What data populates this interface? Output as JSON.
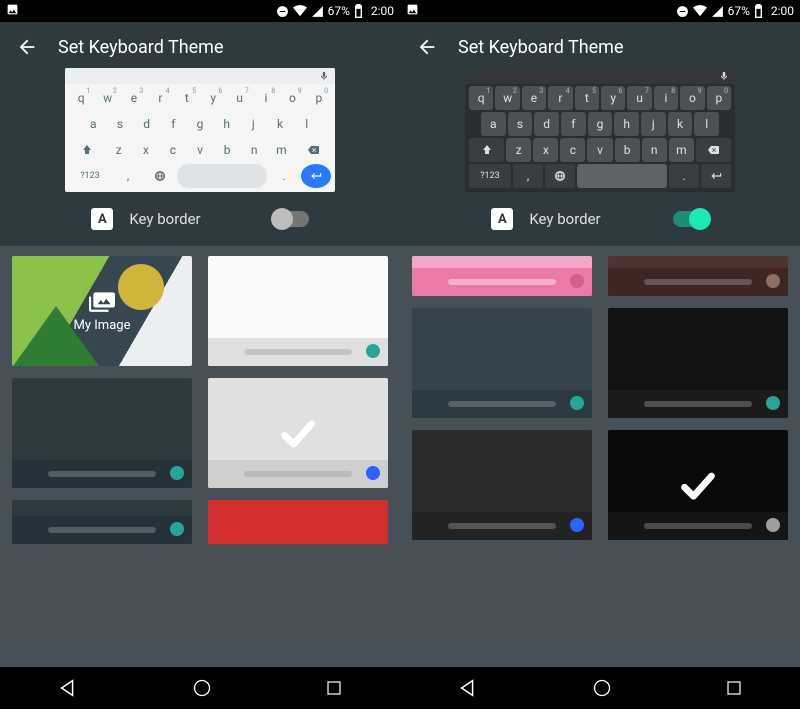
{
  "status": {
    "battery_pct": "67%",
    "time": "2:00"
  },
  "header": {
    "title": "Set Keyboard Theme"
  },
  "keyborder": {
    "label": "Key border",
    "badge_letter": "A"
  },
  "kbd": {
    "row1": [
      {
        "k": "q",
        "n": "1"
      },
      {
        "k": "w",
        "n": "2"
      },
      {
        "k": "e",
        "n": "3"
      },
      {
        "k": "r",
        "n": "4"
      },
      {
        "k": "t",
        "n": "5"
      },
      {
        "k": "y",
        "n": "6"
      },
      {
        "k": "u",
        "n": "7"
      },
      {
        "k": "i",
        "n": "8"
      },
      {
        "k": "o",
        "n": "9"
      },
      {
        "k": "p",
        "n": "0"
      }
    ],
    "row2": [
      "a",
      "s",
      "d",
      "f",
      "g",
      "h",
      "j",
      "k",
      "l"
    ],
    "row3": [
      "z",
      "x",
      "c",
      "v",
      "b",
      "n",
      "m"
    ],
    "symkey": "?123",
    "comma": ",",
    "period": "."
  },
  "panes": {
    "left": {
      "keyborder_on": false,
      "preview_theme": "light",
      "cards": [
        {
          "type": "myimage",
          "label": "My Image"
        },
        {
          "type": "theme",
          "bg": "#fafafa",
          "bar": "#e0e0e0",
          "pill": "#9e9e9e",
          "dot": "#26a69a",
          "selected": false
        },
        {
          "type": "theme",
          "bg": "#2f3a40",
          "bar": "#26323a",
          "pill": "#9e9e9e",
          "dot": "#26a69a",
          "selected": false
        },
        {
          "type": "theme",
          "bg": "#e0e0e0",
          "bar": "#cfcfcf",
          "pill": "#9e9e9e",
          "dot": "#2962ff",
          "selected": true
        },
        {
          "type": "theme",
          "bg": "#2f3a40",
          "bar": "#26323a",
          "pill": "#9e9e9e",
          "dot": "#26a69a",
          "selected": false,
          "partial": true
        },
        {
          "type": "theme",
          "bg": "#d32f2f",
          "bar": "#d32f2f",
          "pill": "#ffffff00",
          "dot": "#ffffff00",
          "selected": false,
          "partial": true
        }
      ]
    },
    "right": {
      "keyborder_on": true,
      "preview_theme": "dark",
      "cards": [
        {
          "type": "theme",
          "bg": "#f1a7c5",
          "bar": "#ec7aa8",
          "pill": "#ffffff",
          "dot": "#d15f8f",
          "selected": false,
          "thin": true
        },
        {
          "type": "theme",
          "bg": "#4e342e",
          "bar": "#3e2723",
          "pill": "#9e9e9e",
          "dot": "#8d6e63",
          "selected": false,
          "thin": true
        },
        {
          "type": "theme",
          "bg": "#34434c",
          "bar": "#2b3940",
          "pill": "#9e9e9e",
          "dot": "#26a69a",
          "selected": false
        },
        {
          "type": "theme",
          "bg": "#121212",
          "bar": "#1b1b1b",
          "pill": "#9e9e9e",
          "dot": "#26a69a",
          "selected": false
        },
        {
          "type": "theme",
          "bg": "#2b2b2b",
          "bar": "#232323",
          "pill": "#9e9e9e",
          "dot": "#2962ff",
          "selected": false
        },
        {
          "type": "theme",
          "bg": "#0a0a0a",
          "bar": "#151515",
          "pill": "#9e9e9e",
          "dot": "#9e9e9e",
          "selected": true
        }
      ]
    }
  }
}
